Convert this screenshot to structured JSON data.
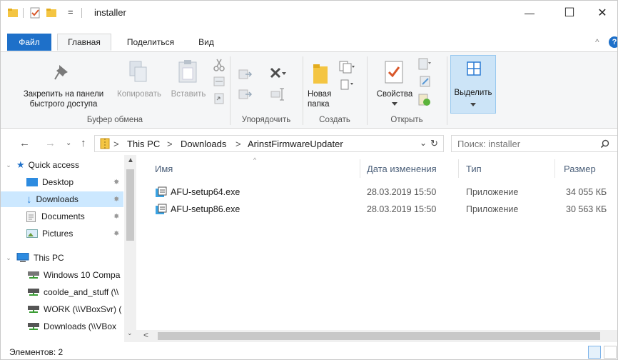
{
  "window": {
    "title": "installer",
    "qa_separator": "=",
    "controls": {
      "minimize": "—",
      "maximize": "☐",
      "close": "✕"
    }
  },
  "tabs": {
    "file": "Файл",
    "items": [
      "Главная",
      "Поделиться",
      "Вид"
    ],
    "active": "Главная",
    "collapse": "^",
    "help": "?"
  },
  "ribbon": {
    "clipboard": {
      "pin_line1": "Закрепить на панели",
      "pin_line2": "быстрого доступа",
      "copy": "Копировать",
      "paste": "Вставить",
      "group": "Буфер обмена"
    },
    "organize": {
      "group": "Упорядочить"
    },
    "create": {
      "new_folder_line1": "Новая",
      "new_folder_line2": "папка",
      "group": "Создать"
    },
    "open": {
      "properties": "Свойства",
      "group": "Открыть"
    },
    "select": {
      "label": "Выделить"
    }
  },
  "address": {
    "crumbs": [
      "This PC",
      "Downloads",
      "ArinstFirmwareUpdater"
    ],
    "separator": ">",
    "search_placeholder": "Поиск: installer"
  },
  "navpane": {
    "items": [
      {
        "label": "Quick access",
        "icon": "star-icon"
      },
      {
        "label": "Desktop",
        "icon": "desktop-icon"
      },
      {
        "label": "Downloads",
        "icon": "download-icon"
      },
      {
        "label": "Documents",
        "icon": "documents-icon"
      },
      {
        "label": "Pictures",
        "icon": "pictures-icon"
      },
      {
        "label": "This PC",
        "icon": "computer-icon"
      },
      {
        "label": "Windows 10 Compa",
        "icon": "network-drive-icon"
      },
      {
        "label": "coolde_and_stuff (\\\\",
        "icon": "network-drive-icon"
      },
      {
        "label": "WORK (\\\\VBoxSvr) (",
        "icon": "network-drive-icon"
      },
      {
        "label": "Downloads (\\\\VBox",
        "icon": "network-drive-icon"
      }
    ]
  },
  "filelist": {
    "columns": [
      "Имя",
      "Дата изменения",
      "Тип",
      "Размер"
    ],
    "rows": [
      {
        "name": "AFU-setup64.exe",
        "date": "28.03.2019 15:50",
        "type": "Приложение",
        "size": "34 055 КБ"
      },
      {
        "name": "AFU-setup86.exe",
        "date": "28.03.2019 15:50",
        "type": "Приложение",
        "size": "30 563 КБ"
      }
    ]
  },
  "status": {
    "count": "Элементов: 2"
  },
  "colors": {
    "accent": "#1e70c9",
    "selection": "#cce8ff",
    "header_text": "#4c607a"
  }
}
